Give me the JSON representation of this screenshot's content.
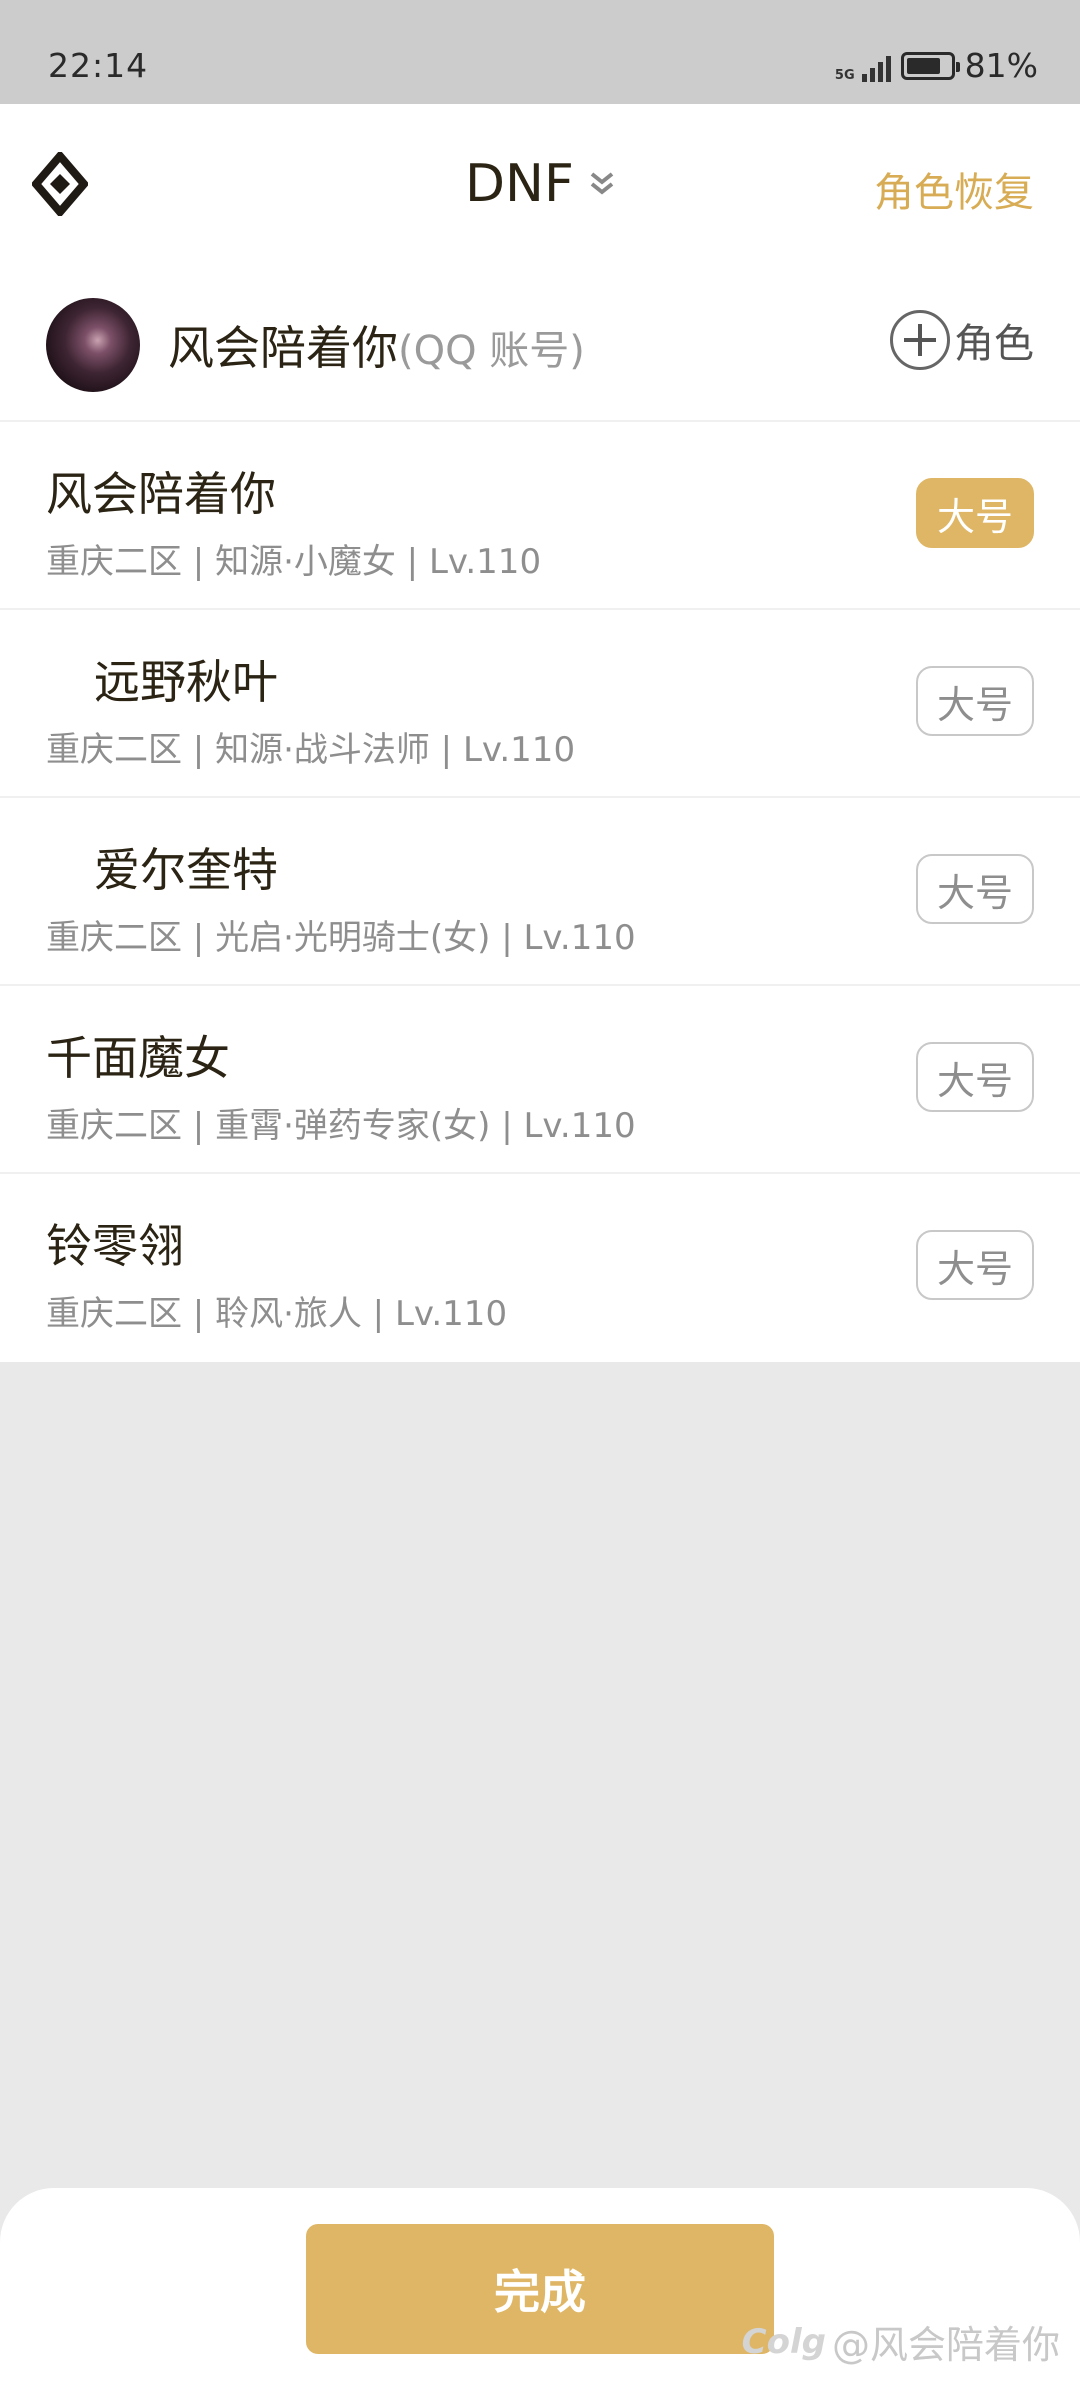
{
  "status_bar": {
    "time": "22:14",
    "network": "5G",
    "battery": "81%"
  },
  "header": {
    "title": "DNF",
    "restore_label": "角色恢复"
  },
  "account": {
    "name": "风会陪着你",
    "type": "(QQ 账号)",
    "add_role_label": "角色"
  },
  "characters": [
    {
      "name": "风会陪着你",
      "info": "重庆二区 | 知源·小魔女 | Lv.110",
      "tag": "大号",
      "selected": true
    },
    {
      "name": "远野秋叶",
      "info": "重庆二区 | 知源·战斗法师 | Lv.110",
      "tag": "大号",
      "selected": false
    },
    {
      "name": "爱尔奎特",
      "info": "重庆二区 | 光启·光明骑士(女) | Lv.110",
      "tag": "大号",
      "selected": false
    },
    {
      "name": "千面魔女",
      "info": "重庆二区 | 重霄·弹药专家(女) | Lv.110",
      "tag": "大号",
      "selected": false
    },
    {
      "name": "铃零翎",
      "info": "重庆二区 | 聆风·旅人 | Lv.110",
      "tag": "大号",
      "selected": false
    }
  ],
  "footer": {
    "done_label": "完成"
  },
  "watermark": {
    "logo": "Colg",
    "text": "@风会陪着你"
  },
  "colors": {
    "accent": "#dfb665",
    "restore_text": "#d7ac55",
    "background": "#e9e9e9",
    "status_bar": "#cccccc"
  }
}
